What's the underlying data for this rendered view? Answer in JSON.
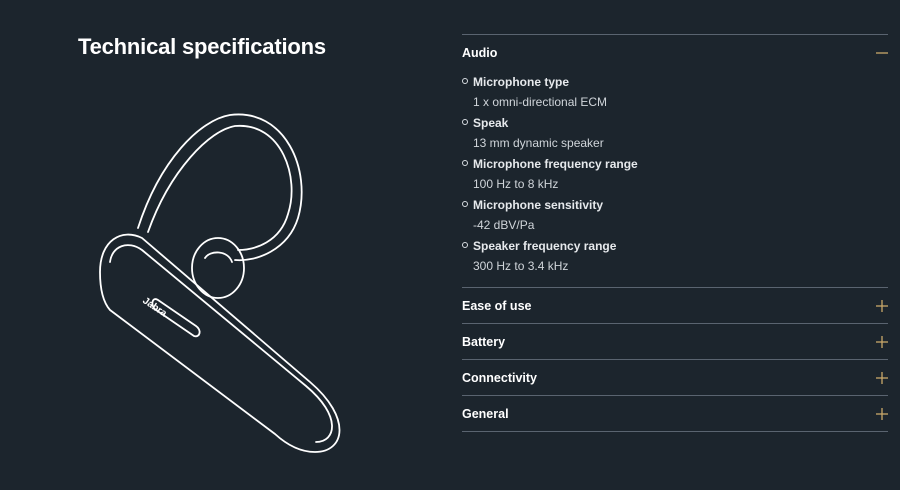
{
  "page": {
    "title": "Technical specifications"
  },
  "product": {
    "brand_mark": "Jabra"
  },
  "colors": {
    "background": "#1c252d",
    "accent": "#c9a76a",
    "divider": "#5a6470",
    "text": "#ffffff"
  },
  "specs": {
    "sections": [
      {
        "title": "Audio",
        "expanded": true,
        "toggle_icon": "minus-icon",
        "items": [
          {
            "name": "Microphone type",
            "value": "1 x omni-directional ECM"
          },
          {
            "name": "Speak",
            "value": "13 mm dynamic speaker"
          },
          {
            "name": "Microphone frequency range",
            "value": "100 Hz to 8 kHz"
          },
          {
            "name": "Microphone sensitivity",
            "value": "-42 dBV/Pa"
          },
          {
            "name": "Speaker frequency range",
            "value": "300 Hz to 3.4 kHz"
          }
        ]
      },
      {
        "title": "Ease of use",
        "expanded": false,
        "toggle_icon": "plus-icon"
      },
      {
        "title": "Battery",
        "expanded": false,
        "toggle_icon": "plus-icon"
      },
      {
        "title": "Connectivity",
        "expanded": false,
        "toggle_icon": "plus-icon"
      },
      {
        "title": "General",
        "expanded": false,
        "toggle_icon": "plus-icon"
      }
    ]
  }
}
